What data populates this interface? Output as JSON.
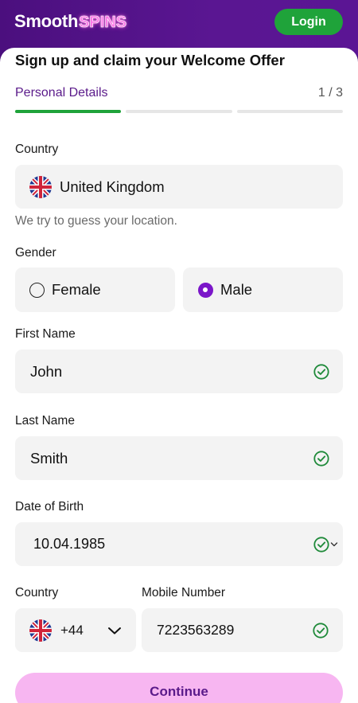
{
  "header": {
    "logo_part1": "Smooth",
    "logo_part2": "SPINS",
    "login_label": "Login"
  },
  "form": {
    "title": "Sign up and claim your Welcome Offer",
    "step_name": "Personal Details",
    "step_count": "1 / 3",
    "progress_steps_completed": 1,
    "progress_steps_total": 3,
    "country_label": "Country",
    "country_value": "United Kingdom",
    "country_hint": "We try to guess your location.",
    "gender_label": "Gender",
    "gender_female": "Female",
    "gender_male": "Male",
    "gender_selected": "Male",
    "first_name_label": "First Name",
    "first_name_value": "John",
    "last_name_label": "Last Name",
    "last_name_value": "Smith",
    "dob_label": "Date of Birth",
    "dob_value": "10.04.1985",
    "phone_country_label": "Country",
    "phone_code": "+44",
    "mobile_label": "Mobile Number",
    "mobile_value": "7223563289",
    "continue_label": "Continue"
  },
  "colors": {
    "brand_purple": "#4b0f7e",
    "accent_green": "#1fa33a",
    "continue_pink": "#f7b6f1",
    "radio_purple": "#7b16c9"
  },
  "icons": {
    "flag": "uk-flag-icon",
    "valid": "check-circle-icon",
    "dropdown": "chevron-down-icon"
  }
}
